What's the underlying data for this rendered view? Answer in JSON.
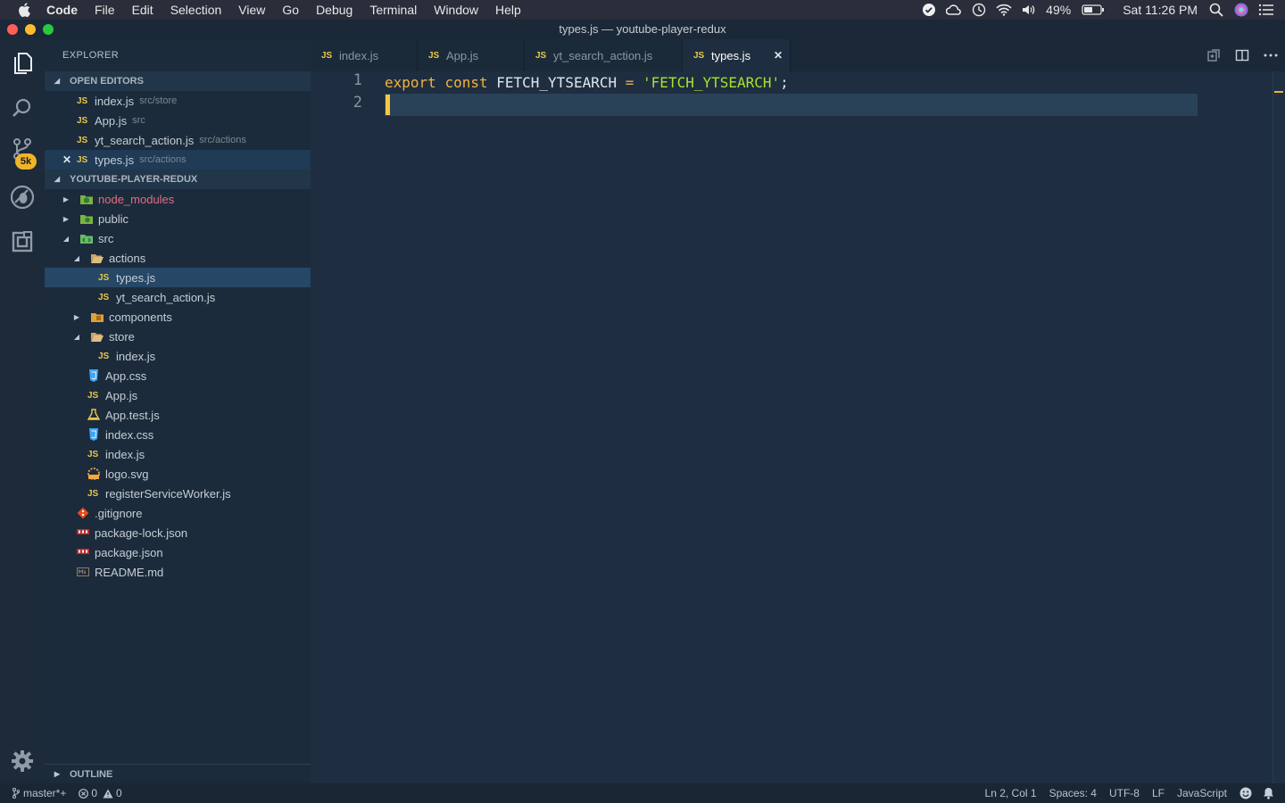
{
  "menubar": {
    "app": "Code",
    "items": [
      "File",
      "Edit",
      "Selection",
      "View",
      "Go",
      "Debug",
      "Terminal",
      "Window",
      "Help"
    ],
    "battery": "49%",
    "clock": "Sat 11:26 PM"
  },
  "window": {
    "title": "types.js — youtube-player-redux"
  },
  "activity": {
    "badge": "5k"
  },
  "sidebar": {
    "title": "EXPLORER",
    "open_editors_header": "OPEN EDITORS",
    "open_editors": [
      {
        "icon": "JS",
        "name": "index.js",
        "desc": "src/store"
      },
      {
        "icon": "JS",
        "name": "App.js",
        "desc": "src"
      },
      {
        "icon": "JS",
        "name": "yt_search_action.js",
        "desc": "src/actions"
      },
      {
        "icon": "JS",
        "name": "types.js",
        "desc": "src/actions"
      }
    ],
    "close_glyph": "✕",
    "project_header": "YOUTUBE-PLAYER-REDUX",
    "tree": [
      {
        "name": "node_modules"
      },
      {
        "name": "public"
      },
      {
        "name": "src"
      },
      {
        "name": "actions"
      },
      {
        "name": "types.js",
        "icon": "JS"
      },
      {
        "name": "yt_search_action.js",
        "icon": "JS"
      },
      {
        "name": "components"
      },
      {
        "name": "store"
      },
      {
        "name": "index.js",
        "icon": "JS"
      },
      {
        "name": "App.css"
      },
      {
        "name": "App.js",
        "icon": "JS"
      },
      {
        "name": "App.test.js"
      },
      {
        "name": "index.css"
      },
      {
        "name": "index.js",
        "icon": "JS"
      },
      {
        "name": "logo.svg"
      },
      {
        "name": "registerServiceWorker.js",
        "icon": "JS"
      },
      {
        "name": ".gitignore"
      },
      {
        "name": "package-lock.json"
      },
      {
        "name": "package.json"
      },
      {
        "name": "README.md"
      }
    ],
    "outline_header": "OUTLINE"
  },
  "tabs": [
    {
      "icon": "JS",
      "label": "index.js"
    },
    {
      "icon": "JS",
      "label": "App.js"
    },
    {
      "icon": "JS",
      "label": "yt_search_action.js"
    },
    {
      "icon": "JS",
      "label": "types.js"
    }
  ],
  "editor": {
    "line_numbers": [
      "1",
      "2"
    ],
    "code": {
      "kw_export": "export",
      "kw_const": "const",
      "identifier": "FETCH_YTSEARCH",
      "operator": "=",
      "string": "'FETCH_YTSEARCH'",
      "terminator": ";"
    }
  },
  "statusbar": {
    "branch": "master*+",
    "errors": "0",
    "warnings": "0",
    "position": "Ln 2, Col 1",
    "spaces": "Spaces: 4",
    "encoding": "UTF-8",
    "eol": "LF",
    "language": "JavaScript"
  },
  "colors": {
    "accent": "#f0b429",
    "editor_bg": "#1e2e40",
    "keyword": "#f2b33d",
    "string": "#a6e22e"
  }
}
